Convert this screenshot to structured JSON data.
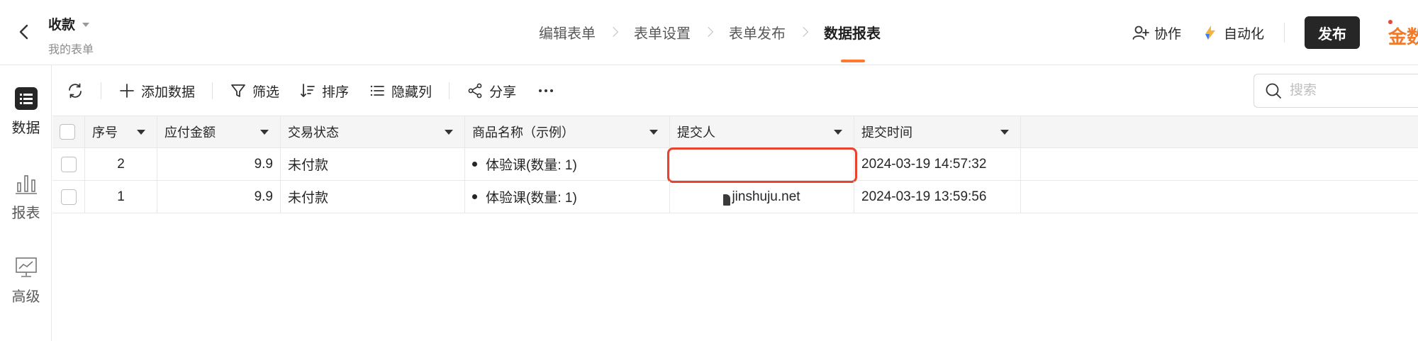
{
  "header": {
    "form_title": "收款",
    "form_subtitle": "我的表单",
    "steps": [
      "编辑表单",
      "表单设置",
      "表单发布",
      "数据报表"
    ],
    "collab_label": "协作",
    "automation_label": "自动化",
    "publish_label": "发布",
    "logo_text": "金数"
  },
  "leftnav": {
    "items": [
      {
        "label": "数据",
        "icon": "list-icon"
      },
      {
        "label": "报表",
        "icon": "bar-chart-icon"
      },
      {
        "label": "高级",
        "icon": "trend-icon"
      }
    ]
  },
  "toolbar": {
    "add_label": "添加数据",
    "filter_label": "筛选",
    "sort_label": "排序",
    "hide_label": "隐藏列",
    "share_label": "分享",
    "search_placeholder": "搜索"
  },
  "table": {
    "columns": [
      "序号",
      "应付金额",
      "交易状态",
      "商品名称（示例）",
      "提交人",
      "提交时间"
    ],
    "rows": [
      {
        "seq": "2",
        "amount": "9.9",
        "status": "未付款",
        "product": "体验课(数量: 1)",
        "submitter": "",
        "time": "2024-03-19 14:57:32"
      },
      {
        "seq": "1",
        "amount": "9.9",
        "status": "未付款",
        "product": "体验课(数量: 1)",
        "submitter": "jinshuju.net",
        "time": "2024-03-19 13:59:56"
      }
    ]
  },
  "colors": {
    "accent": "#ff7a2e",
    "highlight": "#e8432f",
    "publish_bg": "#262626"
  }
}
